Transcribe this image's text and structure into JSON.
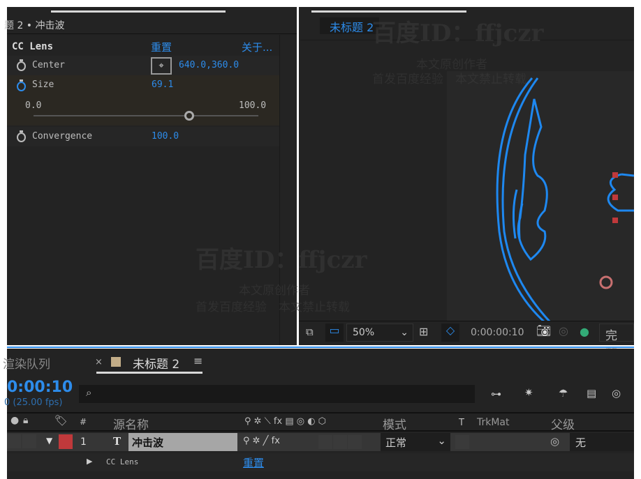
{
  "effects": {
    "title": "题 2 • 冲击波",
    "effect_name": "CC Lens",
    "reset": "重置",
    "about": "关于...",
    "center_label": "Center",
    "center_value": "640.0,360.0",
    "size_label": "Size",
    "size_value": "69.1",
    "size_min": "0.0",
    "size_max": "100.0",
    "size_fraction": 0.691,
    "convergence_label": "Convergence",
    "convergence_value": "100.0"
  },
  "viewer": {
    "tab": "未标题 2",
    "zoom": "50%",
    "timecode": "0:00:00:10",
    "resolution": "完整"
  },
  "timeline": {
    "tab_render": "渲染队列",
    "tab_comp": "未标题 2",
    "timecode": "0:00:10",
    "fps": "0 (25.00 fps)",
    "headers": {
      "num": "#",
      "source": "源名称",
      "mode": "模式",
      "t": "T",
      "trkmat": "TrkMat",
      "parent": "父级"
    },
    "layer": {
      "index": "1",
      "type": "T",
      "name": "冲击波",
      "mode": "正常",
      "parent": "无",
      "label_color": "#c0393b"
    },
    "sub": {
      "name": "CC Lens",
      "reset": "重置"
    }
  },
  "watermark": {
    "id": "百度ID：ffjczr",
    "line1": "本文原创作者",
    "line2": "首发百度经验　本文禁止转载"
  },
  "colors": {
    "accent": "#2d8ceb",
    "shape": "#1e88f0",
    "handle": "#c0393b"
  }
}
